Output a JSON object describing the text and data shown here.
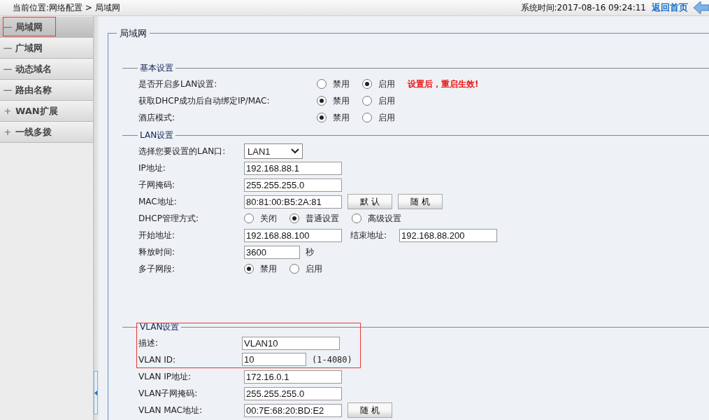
{
  "topbar": {
    "location": "当前位置:网络配置 > 局域网",
    "system_time": "系统时间:2017-08-16 09:24:11",
    "home_link": "返回首页"
  },
  "sidebar": {
    "items": [
      {
        "sign": "—",
        "label": "局域网",
        "selected": true,
        "highlighted": true
      },
      {
        "sign": "—",
        "label": "广域网",
        "selected": false,
        "highlighted": false
      },
      {
        "sign": "—",
        "label": "动态域名",
        "selected": false,
        "highlighted": false
      },
      {
        "sign": "—",
        "label": "路由名称",
        "selected": false,
        "highlighted": false
      },
      {
        "sign": "+",
        "label": "WAN扩展",
        "selected": false,
        "highlighted": false
      },
      {
        "sign": "+",
        "label": "一线多拨",
        "selected": false,
        "highlighted": false
      }
    ]
  },
  "panel": {
    "title": "局域网",
    "sections": [
      {
        "title": "基本设置",
        "highlighted": false,
        "rows": [
          {
            "label": "是否开启多LAN设置:",
            "highlighted": false,
            "controls": [
              {
                "kind": "radio",
                "options": [
                  {
                    "label": "禁用",
                    "selected": false
                  },
                  {
                    "label": "启用",
                    "selected": true
                  }
                ]
              },
              {
                "kind": "warning",
                "text": "设置后，重启生效!"
              }
            ]
          },
          {
            "label": "获取DHCP成功后自动绑定IP/MAC:",
            "highlighted": false,
            "controls": [
              {
                "kind": "radio",
                "options": [
                  {
                    "label": "禁用",
                    "selected": true
                  },
                  {
                    "label": "启用",
                    "selected": false
                  }
                ]
              }
            ]
          },
          {
            "label": "酒店模式:",
            "highlighted": false,
            "controls": [
              {
                "kind": "radio",
                "options": [
                  {
                    "label": "禁用",
                    "selected": true
                  },
                  {
                    "label": "启用",
                    "selected": false
                  }
                ]
              }
            ]
          }
        ]
      },
      {
        "title": "LAN设置",
        "highlighted": false,
        "rows": [
          {
            "label": "选择您要设置的LAN口:",
            "highlighted": false,
            "controls": [
              {
                "kind": "select",
                "value": "LAN1"
              }
            ]
          },
          {
            "label": "IP地址:",
            "highlighted": false,
            "controls": [
              {
                "kind": "input",
                "value": "192.168.88.1"
              }
            ]
          },
          {
            "label": "子网掩码:",
            "highlighted": false,
            "controls": [
              {
                "kind": "input",
                "value": "255.255.255.0"
              }
            ]
          },
          {
            "label": "MAC地址:",
            "highlighted": false,
            "controls": [
              {
                "kind": "input",
                "value": "80:81:00:B5:2A:81"
              },
              {
                "kind": "button",
                "text": "默 认"
              },
              {
                "kind": "button",
                "text": "随 机"
              }
            ]
          },
          {
            "label": "DHCP管理方式:",
            "highlighted": false,
            "controls": [
              {
                "kind": "radio",
                "options": [
                  {
                    "label": "关闭",
                    "selected": false
                  },
                  {
                    "label": "普通设置",
                    "selected": true
                  },
                  {
                    "label": "高级设置",
                    "selected": false
                  }
                ]
              }
            ]
          },
          {
            "label": "开始地址:",
            "highlighted": false,
            "controls": [
              {
                "kind": "input",
                "value": "192.168.88.100"
              },
              {
                "kind": "label",
                "text": "结束地址:"
              },
              {
                "kind": "input",
                "value": "192.168.88.200"
              }
            ]
          },
          {
            "label": "释放时间:",
            "highlighted": false,
            "controls": [
              {
                "kind": "short_input",
                "value": "3600"
              },
              {
                "kind": "text",
                "text": "秒"
              }
            ]
          },
          {
            "label": "多子网段:",
            "highlighted": false,
            "controls": [
              {
                "kind": "radio",
                "options": [
                  {
                    "label": "禁用",
                    "selected": true
                  },
                  {
                    "label": "启用",
                    "selected": false
                  }
                ]
              }
            ]
          }
        ]
      },
      {
        "title": "VLAN设置",
        "highlighted": true,
        "rows": [
          {
            "label": "描述:",
            "highlighted": true,
            "controls": [
              {
                "kind": "input",
                "value": "VLAN10"
              }
            ]
          },
          {
            "label": "VLAN ID:",
            "highlighted": true,
            "controls": [
              {
                "kind": "id_input",
                "value": "10"
              },
              {
                "kind": "text",
                "text": "(1-4080)"
              }
            ]
          },
          {
            "label": "VLAN IP地址:",
            "highlighted": false,
            "controls": [
              {
                "kind": "input",
                "value": "172.16.0.1"
              }
            ]
          },
          {
            "label": "VLAN子网掩码:",
            "highlighted": false,
            "controls": [
              {
                "kind": "input",
                "value": "255.255.255.0"
              }
            ]
          },
          {
            "label": "VLAN MAC地址:",
            "highlighted": false,
            "controls": [
              {
                "kind": "input",
                "value": "00:7E:68:20:BD:E2"
              },
              {
                "kind": "button",
                "text": "随 机"
              }
            ]
          }
        ]
      }
    ]
  }
}
